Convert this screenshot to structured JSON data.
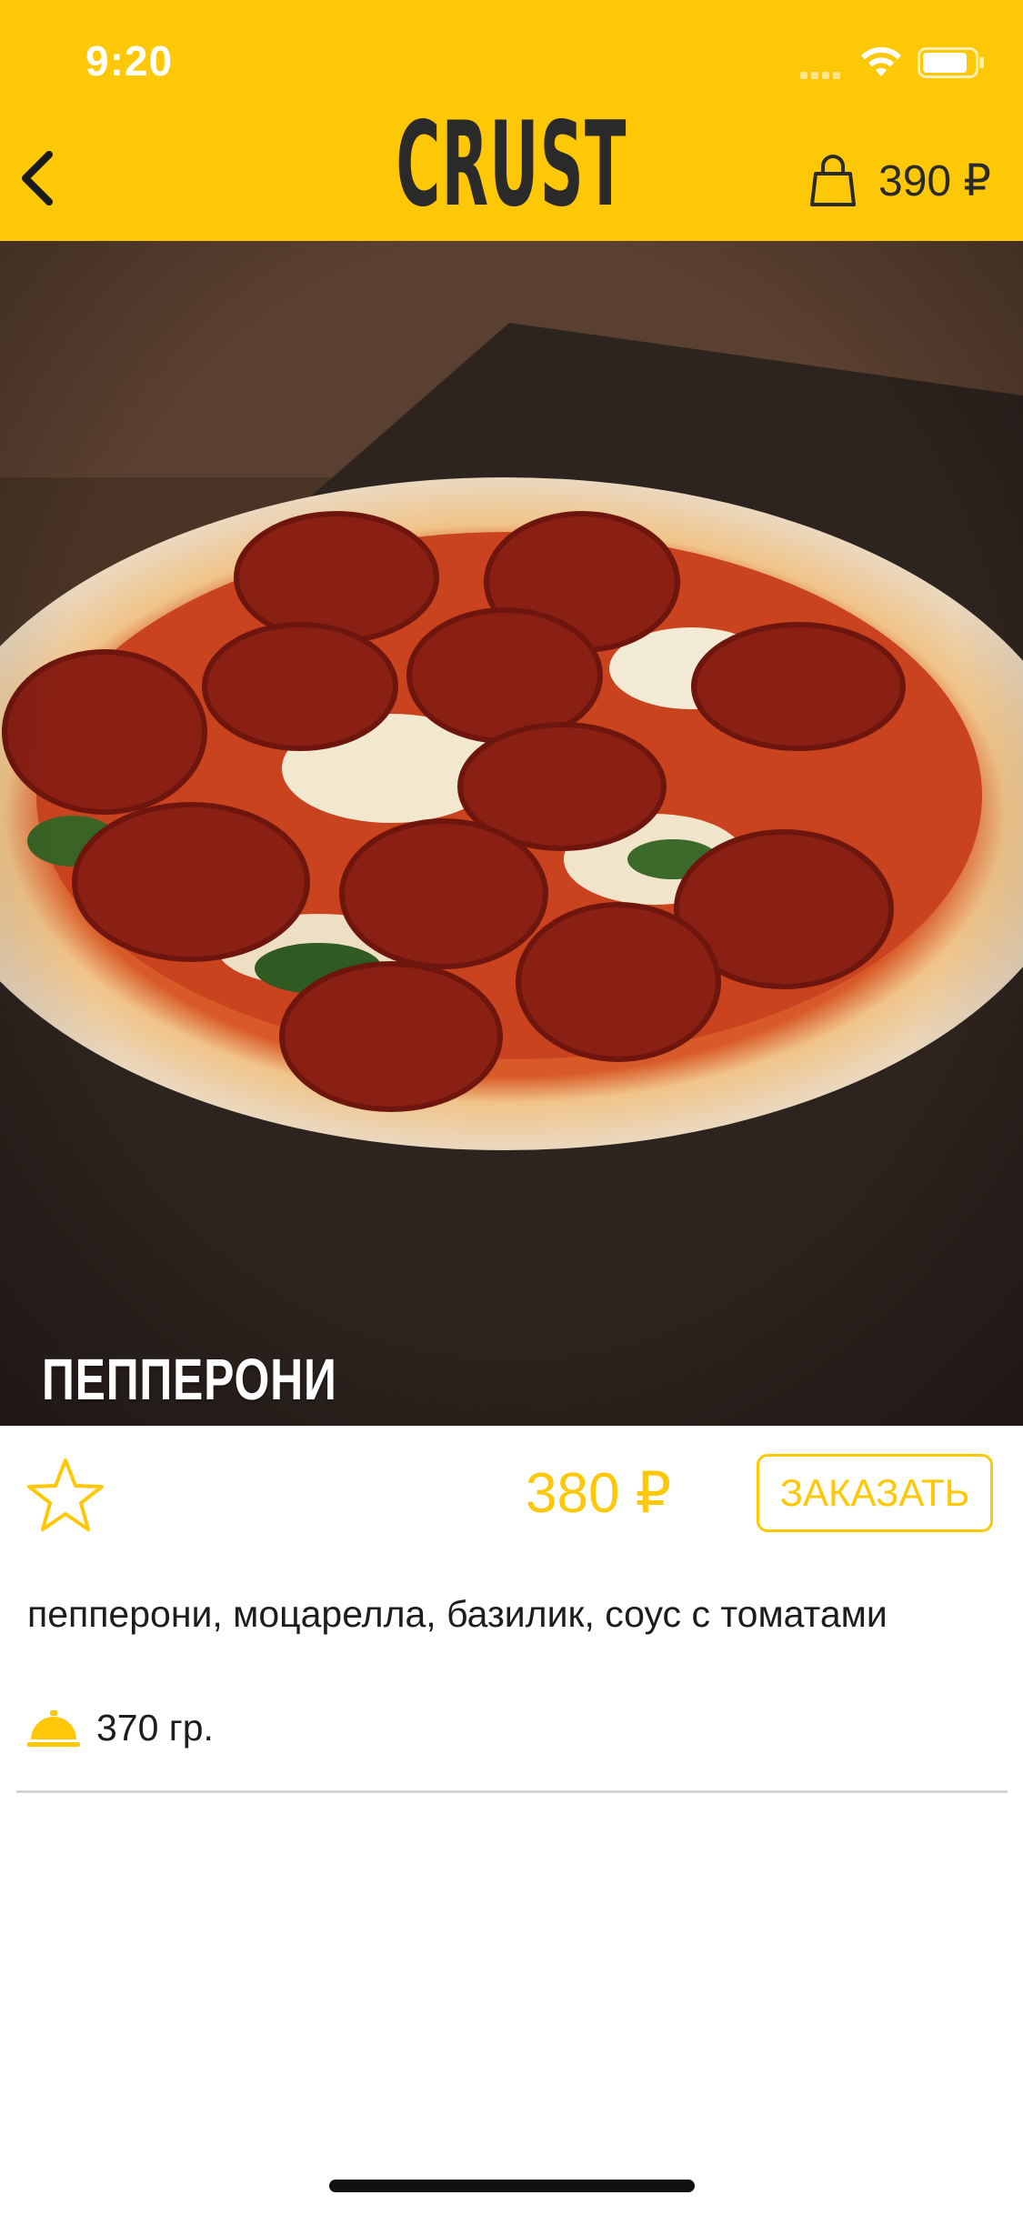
{
  "status_bar": {
    "time": "9:20",
    "icons": [
      "signal-dots-icon",
      "wifi-icon",
      "battery-icon"
    ]
  },
  "header": {
    "back_icon": "chevron-left-icon",
    "brand": "CRUST",
    "cart_icon": "shopping-bag-icon",
    "cart_total": "390 ₽"
  },
  "product": {
    "name": "ПЕППЕРОНИ",
    "price": "380 ₽",
    "order_label": "ЗАКАЗАТЬ",
    "favorite_icon": "star-outline-icon",
    "ingredients": "пепперони, моцарелла, базилик, соус с томатами",
    "weight_icon": "cloche-icon",
    "weight": "370 гр."
  },
  "colors": {
    "accent": "#FEC806",
    "text": "#1d1d1d",
    "logo": "#2a2a2a"
  }
}
